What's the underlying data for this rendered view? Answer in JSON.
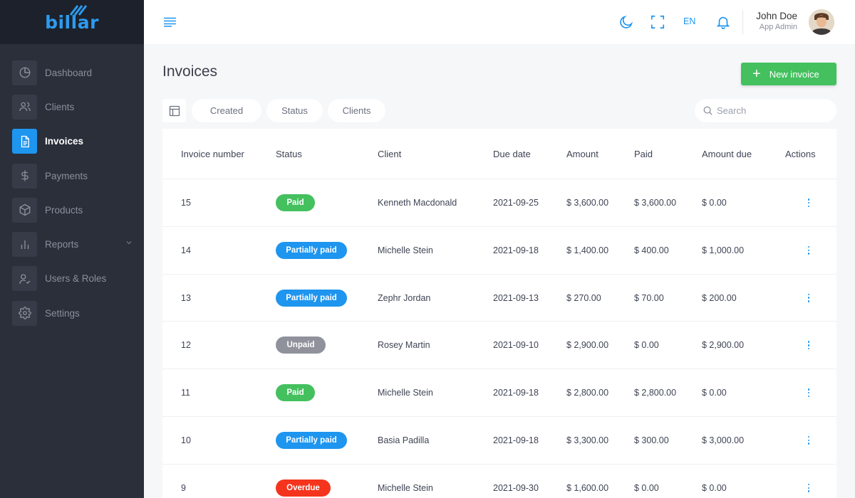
{
  "brand": {
    "name": "billar"
  },
  "sidebar": {
    "items": [
      {
        "label": "Dashboard",
        "icon": "pie-chart-icon"
      },
      {
        "label": "Clients",
        "icon": "users-icon"
      },
      {
        "label": "Invoices",
        "icon": "document-icon",
        "active": true
      },
      {
        "label": "Payments",
        "icon": "dollar-icon"
      },
      {
        "label": "Products",
        "icon": "box-icon"
      },
      {
        "label": "Reports",
        "icon": "bar-chart-icon",
        "expandable": true
      },
      {
        "label": "Users & Roles",
        "icon": "user-check-icon"
      },
      {
        "label": "Settings",
        "icon": "gear-icon"
      }
    ]
  },
  "topbar": {
    "language": "EN",
    "user": {
      "name": "John Doe",
      "role": "App Admin"
    }
  },
  "page": {
    "title": "Invoices",
    "new_button": "New invoice"
  },
  "filters": {
    "chips": [
      "Created",
      "Status",
      "Clients"
    ],
    "search_placeholder": "Search"
  },
  "table": {
    "columns": [
      "Invoice number",
      "Status",
      "Client",
      "Due date",
      "Amount",
      "Paid",
      "Amount due",
      "Actions"
    ],
    "rows": [
      {
        "number": "15",
        "status": "Paid",
        "client": "Kenneth Macdonald",
        "due": "2021-09-25",
        "amount": "$ 3,600.00",
        "paid": "$ 3,600.00",
        "amount_due": "$ 0.00"
      },
      {
        "number": "14",
        "status": "Partially paid",
        "client": "Michelle Stein",
        "due": "2021-09-18",
        "amount": "$ 1,400.00",
        "paid": "$ 400.00",
        "amount_due": "$ 1,000.00"
      },
      {
        "number": "13",
        "status": "Partially paid",
        "client": "Zephr Jordan",
        "due": "2021-09-13",
        "amount": "$ 270.00",
        "paid": "$ 70.00",
        "amount_due": "$ 200.00"
      },
      {
        "number": "12",
        "status": "Unpaid",
        "client": "Rosey Martin",
        "due": "2021-09-10",
        "amount": "$ 2,900.00",
        "paid": "$ 0.00",
        "amount_due": "$ 2,900.00"
      },
      {
        "number": "11",
        "status": "Paid",
        "client": "Michelle Stein",
        "due": "2021-09-18",
        "amount": "$ 2,800.00",
        "paid": "$ 2,800.00",
        "amount_due": "$ 0.00"
      },
      {
        "number": "10",
        "status": "Partially paid",
        "client": "Basia Padilla",
        "due": "2021-09-18",
        "amount": "$ 3,300.00",
        "paid": "$ 300.00",
        "amount_due": "$ 3,000.00"
      },
      {
        "number": "9",
        "status": "Overdue",
        "client": "Michelle Stein",
        "due": "2021-09-30",
        "amount": "$ 1,600.00",
        "paid": "$ 0.00",
        "amount_due": "$ 0.00"
      }
    ]
  },
  "colors": {
    "accent": "#1e95ef",
    "paid": "#44c05f",
    "partially_paid": "#1e95ef",
    "unpaid": "#8f929b",
    "overdue": "#f5341d"
  }
}
